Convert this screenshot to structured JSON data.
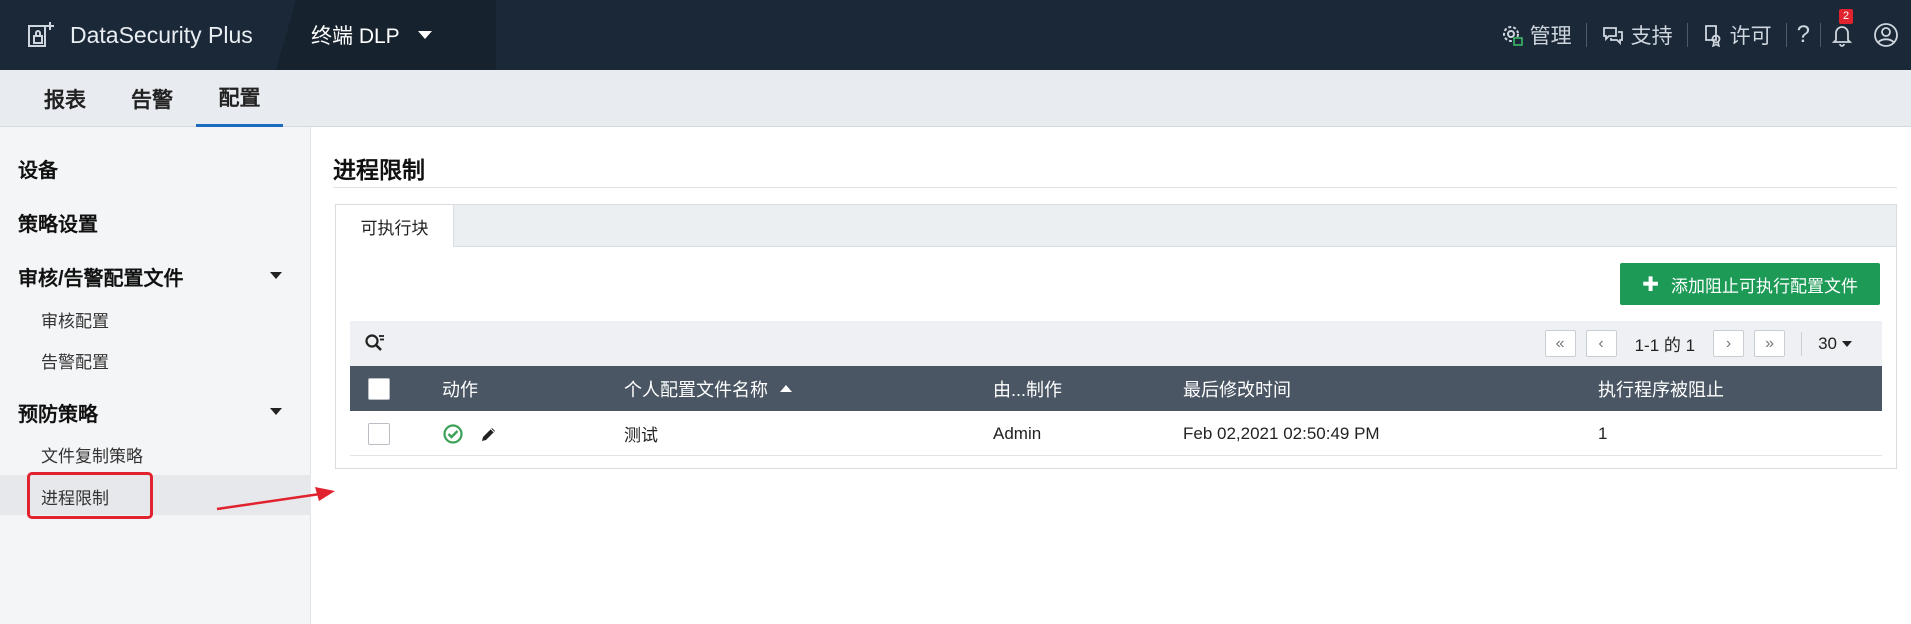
{
  "header": {
    "brand": "DataSecurity Plus",
    "product": "终端 DLP",
    "links": [
      {
        "label": "管理",
        "icon": "gear-icon"
      },
      {
        "label": "支持",
        "icon": "chat-icon"
      },
      {
        "label": "许可",
        "icon": "license-icon"
      }
    ],
    "help": "?",
    "notifications_count": "2"
  },
  "subnav": {
    "tabs": [
      {
        "label": "报表"
      },
      {
        "label": "告警"
      },
      {
        "label": "配置"
      }
    ],
    "active": "配置"
  },
  "sidebar": {
    "devices": "设备",
    "policy_settings": "策略设置",
    "audit_alert_profiles": {
      "label": "审核/告警配置文件",
      "items": [
        "审核配置",
        "告警配置"
      ]
    },
    "prevention_policies": {
      "label": "预防策略",
      "items": [
        "文件复制策略",
        "进程限制"
      ]
    },
    "active_item": "进程限制"
  },
  "main": {
    "title": "进程限制",
    "tab": "可执行块",
    "add_button": "添加阻止可执行配置文件",
    "pager": {
      "first": "«",
      "prev": "‹",
      "range": "1-1 的 1",
      "next": "›",
      "last": "»",
      "per_page": "30"
    },
    "table": {
      "columns": [
        "动作",
        "个人配置文件名称",
        "由...制作",
        "最后修改时间",
        "执行程序被阻止"
      ],
      "rows": [
        {
          "name": "测试",
          "created_by": "Admin",
          "modified": "Feb 02,2021 02:50:49 PM",
          "blocked": "1"
        }
      ]
    }
  },
  "colors": {
    "topbar": "#1b2838",
    "accent_green": "#1e9a57",
    "table_header": "#4a5663",
    "highlight": "#e0232e",
    "active_tab_underline": "#1b6bbf"
  }
}
